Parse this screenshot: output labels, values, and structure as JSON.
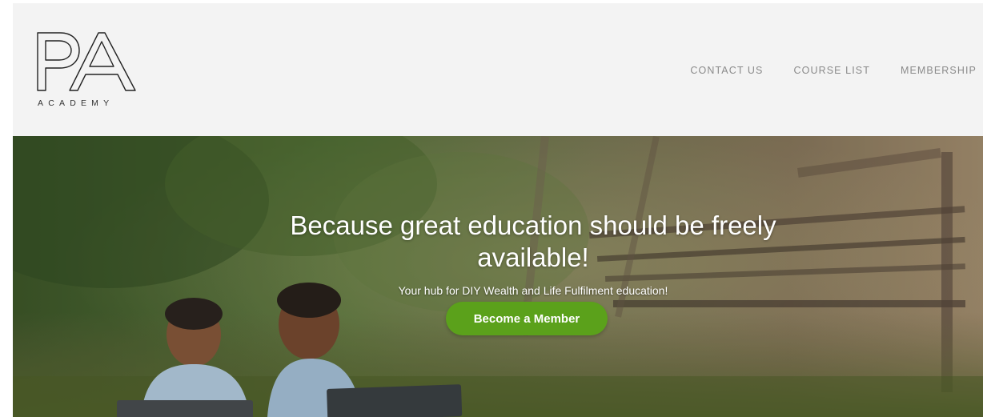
{
  "header": {
    "logo_monogram": "PA",
    "logo_wordmark": "ACADEMY",
    "nav": [
      {
        "label": "CONTACT US"
      },
      {
        "label": "COURSE LIST"
      },
      {
        "label": "MEMBERSHIP"
      }
    ]
  },
  "hero": {
    "headline": "Because great education should be freely available!",
    "subline": "Your hub for DIY Wealth and Life Fulfilment education!",
    "cta_label": "Become a Member",
    "cta_color": "#5ba11b"
  }
}
